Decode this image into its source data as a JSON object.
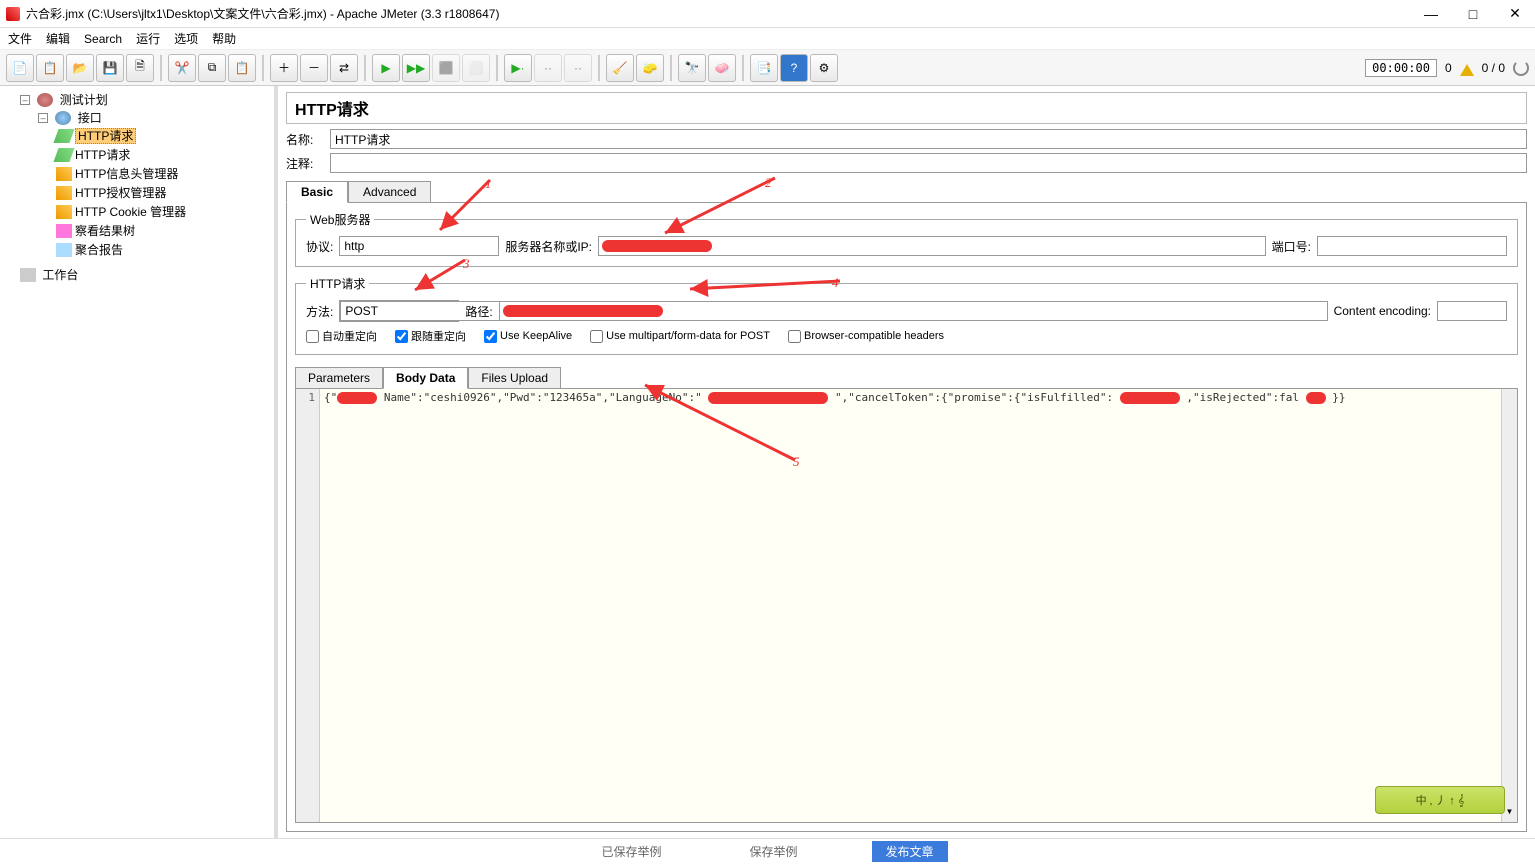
{
  "window": {
    "title": "六合彩.jmx (C:\\Users\\jltx1\\Desktop\\文案文件\\六合彩.jmx) - Apache JMeter (3.3 r1808647)"
  },
  "menubar": [
    "文件",
    "编辑",
    "Search",
    "运行",
    "选项",
    "帮助"
  ],
  "toolbar_right": {
    "timer": "00:00:00",
    "errcount": "0",
    "ratio": "0 / 0"
  },
  "tree": {
    "root": "测试计划",
    "group": "接口",
    "items": [
      "HTTP请求",
      "HTTP请求",
      "HTTP信息头管理器",
      "HTTP授权管理器",
      "HTTP Cookie 管理器",
      "察看结果树",
      "聚合报告"
    ],
    "selected_index": 0,
    "workbench": "工作台"
  },
  "panel": {
    "title": "HTTP请求",
    "name_label": "名称:",
    "name_value": "HTTP请求",
    "comment_label": "注释:",
    "comment_value": ""
  },
  "tabs": {
    "basic": "Basic",
    "advanced": "Advanced"
  },
  "webserver": {
    "legend": "Web服务器",
    "protocol_label": "协议:",
    "protocol_value": "http",
    "server_label": "服务器名称或IP:",
    "port_label": "端口号:",
    "port_value": ""
  },
  "httpreq": {
    "legend": "HTTP请求",
    "method_label": "方法:",
    "method_value": "POST",
    "path_label": "路径:",
    "encoding_label": "Content encoding:",
    "encoding_value": ""
  },
  "checkboxes": {
    "auto_redirect": "自动重定向",
    "follow_redirect": "跟随重定向",
    "keepalive": "Use KeepAlive",
    "multipart": "Use multipart/form-data for POST",
    "browser_compat": "Browser-compatible headers"
  },
  "subtabs": {
    "params": "Parameters",
    "body": "Body Data",
    "files": "Files Upload"
  },
  "editor": {
    "line_no": "1",
    "body_fragments": {
      "a": "Name\":\"ceshi0926\",\"Pwd\":\"123465a\",\"LanguageNo\":\"",
      "b": "\",\"cancelToken\":{\"promise\":{\"isFulfilled\":",
      "c": ",\"isRejected\":fal",
      "d": "}}"
    }
  },
  "softkbd": "中 ‚ 丿 ↑ 𝄞",
  "annotations": {
    "n1": "1",
    "n2": "2",
    "n3": "3",
    "n4": "4",
    "n5": "5"
  },
  "taskbar": {
    "a": "已保存举例",
    "b": "保存举例",
    "c": "发布文章"
  }
}
